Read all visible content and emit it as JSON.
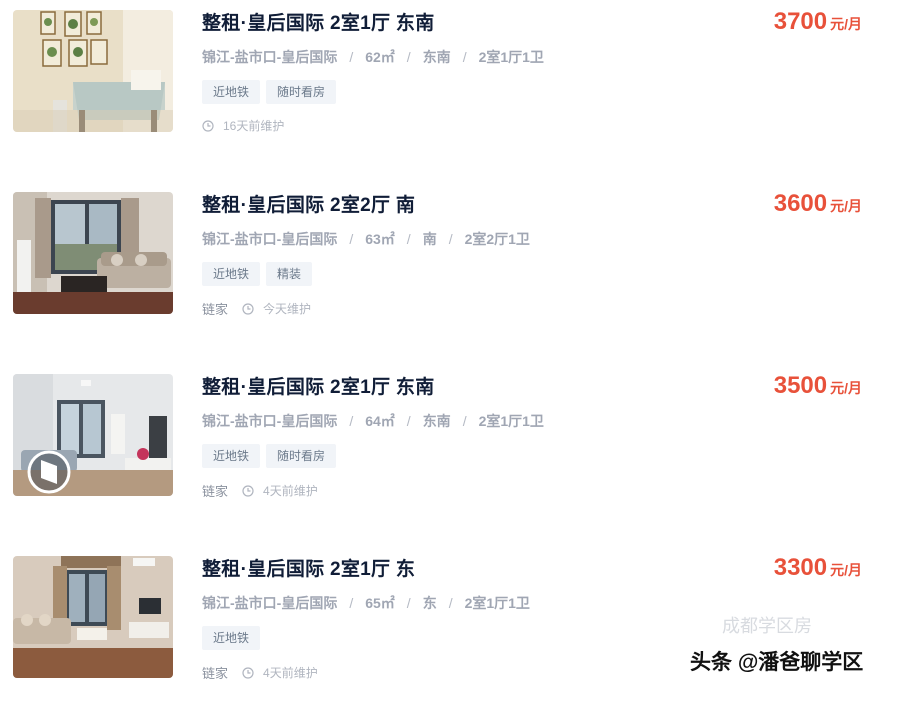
{
  "listings": [
    {
      "title": "整租·皇后国际 2室1厅 东南",
      "price": "3700",
      "price_unit": "元/月",
      "location": "锦江-盐市口-皇后国际",
      "area": "62㎡",
      "orientation": "东南",
      "layout": "2室1厅1卫",
      "tags": [
        "近地铁",
        "随时看房"
      ],
      "brand": "",
      "maintained": "16天前维护",
      "photo_icon": "dining-room-photo"
    },
    {
      "title": "整租·皇后国际 2室2厅 南",
      "price": "3600",
      "price_unit": "元/月",
      "location": "锦江-盐市口-皇后国际",
      "area": "63㎡",
      "orientation": "南",
      "layout": "2室2厅1卫",
      "tags": [
        "近地铁",
        "精装"
      ],
      "brand": "链家",
      "maintained": "今天维护",
      "photo_icon": "living-room-window-photo"
    },
    {
      "title": "整租·皇后国际 2室1厅 东南",
      "price": "3500",
      "price_unit": "元/月",
      "location": "锦江-盐市口-皇后国际",
      "area": "64㎡",
      "orientation": "东南",
      "layout": "2室1厅1卫",
      "tags": [
        "近地铁",
        "随时看房"
      ],
      "brand": "链家",
      "maintained": "4天前维护",
      "photo_icon": "living-room-vr-photo"
    },
    {
      "title": "整租·皇后国际 2室1厅 东",
      "price": "3300",
      "price_unit": "元/月",
      "location": "锦江-盐市口-皇后国际",
      "area": "65㎡",
      "orientation": "东",
      "layout": "2室1厅1卫",
      "tags": [
        "近地铁"
      ],
      "brand": "链家",
      "maintained": "4天前维护",
      "photo_icon": "living-room-sofa-photo"
    }
  ],
  "separator": "/",
  "watermark": "头条 @潘爸聊学区",
  "faint_overlay": "成都学区房",
  "colors": {
    "price": "#e8513a",
    "title": "#101d37",
    "tag_bg": "#f1f4f8",
    "tag_text": "#6c7a8b",
    "muted": "#a0a6b3"
  }
}
